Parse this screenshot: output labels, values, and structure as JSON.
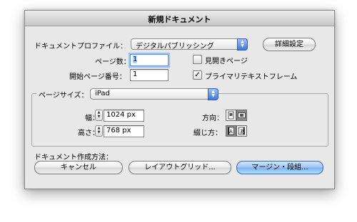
{
  "dialog": {
    "title": "新規ドキュメント",
    "profile_label": "ドキュメントプロファイル：",
    "profile_value": "デジタルパブリッシング",
    "details_button": "詳細設定",
    "pages_label": "ページ数：",
    "pages_value": "1",
    "start_page_label": "開始ページ番号：",
    "start_page_value": "1",
    "facing_pages_label": "見開きページ",
    "facing_pages_checked": false,
    "primary_frame_label": "プライマリテキストフレーム",
    "primary_frame_checked": true,
    "page_size_label": "ページサイズ：",
    "page_size_value": "iPad",
    "width_label": "幅：",
    "width_value": "1024 px",
    "height_label": "高さ：",
    "height_value": "768 px",
    "orientation_label": "方向：",
    "binding_label": "綴じ方：",
    "create_method_label": "ドキュメント作成方法：",
    "cancel_button": "キャンセル",
    "layout_grid_button": "レイアウトグリッド...",
    "margins_columns_button": "マージン・段組...",
    "icons": {
      "orientation_portrait": "portrait-orientation-icon",
      "orientation_landscape": "landscape-orientation-icon",
      "binding_left": "left-binding-icon",
      "binding_right": "right-binding-icon"
    }
  }
}
